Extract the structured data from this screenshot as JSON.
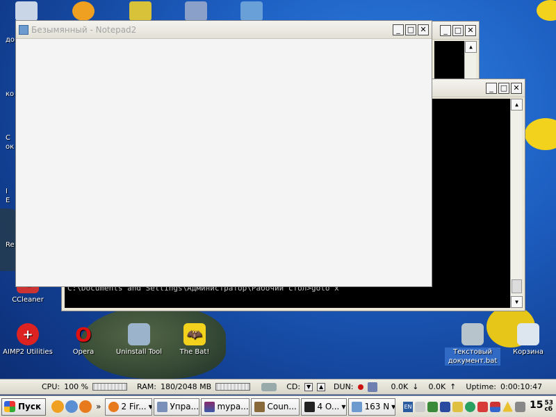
{
  "desktop": {
    "icons": [
      {
        "label": "CCleaner"
      },
      {
        "label": "AIMP2 Utilities"
      },
      {
        "label": "Opera"
      },
      {
        "label": "Uninstall Tool"
      },
      {
        "label": "The Bat!"
      },
      {
        "label": "Текстовый документ.bat"
      },
      {
        "label": "Корзина"
      }
    ],
    "left_fragments": [
      "до",
      "ко",
      "С",
      "ок",
      "I",
      "Е",
      "Re"
    ]
  },
  "notepad": {
    "title": "Безымянный - Notepad2"
  },
  "console_front": {
    "line": "C:\\Documents and Settings\\Администратор\\Рабочий стол>goto x"
  },
  "window_buttons": {
    "minimize": "_",
    "maximize": "□",
    "close": "✕"
  },
  "meter": {
    "cpu_label": "CPU:",
    "cpu_value": "100 %",
    "ram_label": "RAM:",
    "ram_value": "180/2048 MB",
    "cd_label": "CD:",
    "dun_label": "DUN:",
    "net_down": "0.0K",
    "net_up": "0.0K",
    "uptime_label": "Uptime:",
    "uptime_value": "0:00:10:47"
  },
  "taskbar": {
    "start_label": "Пуск",
    "buttons": [
      {
        "label": "2 Fir..."
      },
      {
        "label": "Упра..."
      },
      {
        "label": "mypa..."
      },
      {
        "label": "Coun..."
      },
      {
        "label": "4 O..."
      },
      {
        "label": "163 N"
      }
    ],
    "tray_lang": "EN",
    "clock_hours": "15",
    "clock_minutes": "53",
    "clock_day": "сб"
  }
}
